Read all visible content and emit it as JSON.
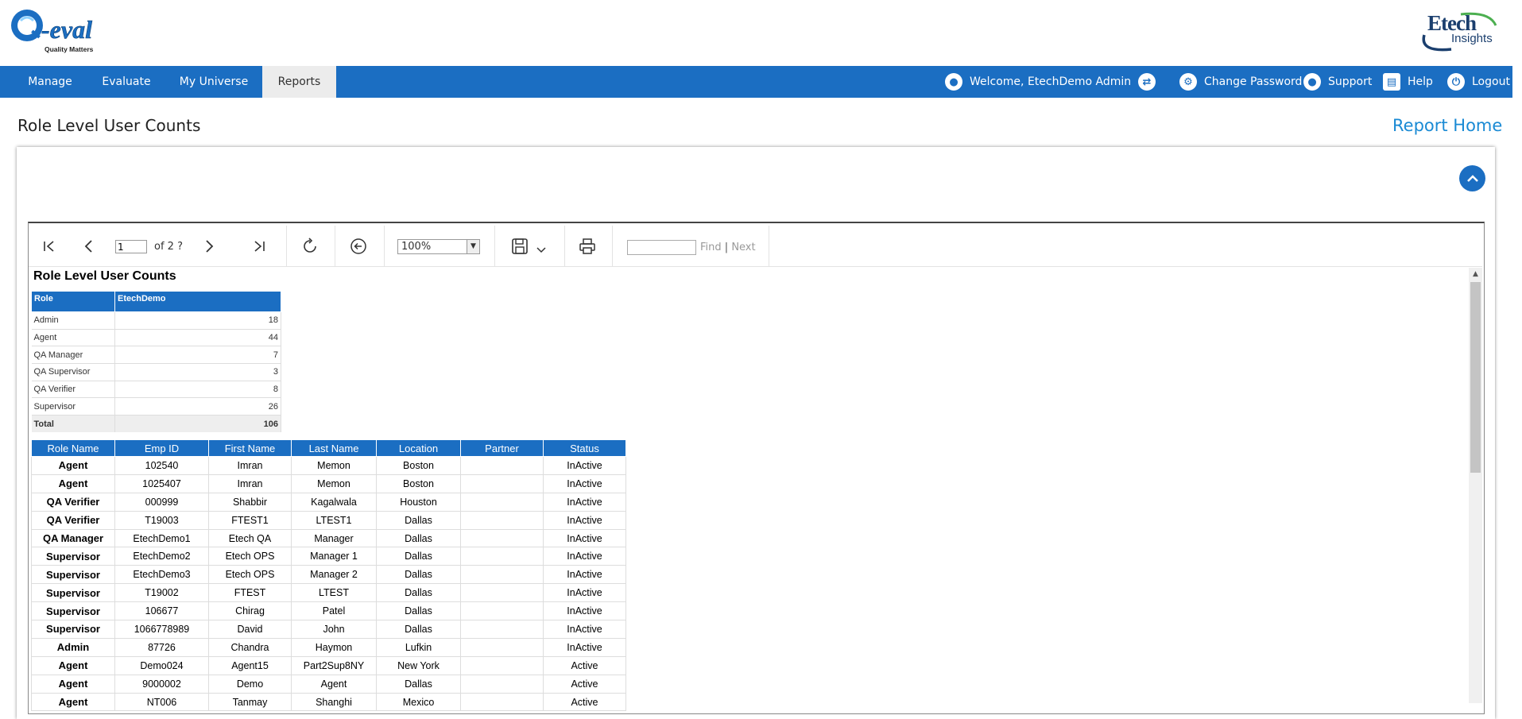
{
  "header": {
    "logo_left_text": "Q-Eval",
    "logo_left_tagline": "Quality Matters",
    "logo_right_text": "Etech",
    "logo_right_sub": "Insights"
  },
  "nav": {
    "items": [
      {
        "label": "Manage"
      },
      {
        "label": "Evaluate"
      },
      {
        "label": "My Universe"
      },
      {
        "label": "Reports"
      }
    ],
    "active": "Reports",
    "welcome": "Welcome, EtechDemo Admin",
    "change_password": "Change Password",
    "support": "Support",
    "help": "Help",
    "logout": "Logout"
  },
  "page": {
    "title": "Role Level User Counts",
    "report_home": "Report Home"
  },
  "toolbar": {
    "page_value": "1",
    "page_of": "of 2 ?",
    "zoom": "100%",
    "find_label": "Find",
    "separator": "|",
    "next_label": "Next"
  },
  "report": {
    "title": "Role Level User Counts",
    "summary_headers": [
      "Role",
      "EtechDemo"
    ],
    "summary_rows": [
      {
        "role": "Admin",
        "count": "18"
      },
      {
        "role": "Agent",
        "count": "44"
      },
      {
        "role": "QA Manager",
        "count": "7"
      },
      {
        "role": "QA Supervisor",
        "count": "3"
      },
      {
        "role": "QA Verifier",
        "count": "8"
      },
      {
        "role": "Supervisor",
        "count": "26"
      }
    ],
    "summary_total": {
      "label": "Total",
      "count": "106"
    },
    "detail_headers": [
      "Role Name",
      "Emp ID",
      "First Name",
      "Last Name",
      "Location",
      "Partner",
      "Status"
    ],
    "detail_rows": [
      [
        "Agent",
        "102540",
        "Imran",
        "Memon",
        "Boston",
        "",
        "InActive"
      ],
      [
        "Agent",
        "1025407",
        "Imran",
        "Memon",
        "Boston",
        "",
        "InActive"
      ],
      [
        "QA Verifier",
        "000999",
        "Shabbir",
        "Kagalwala",
        "Houston",
        "",
        "InActive"
      ],
      [
        "QA Verifier",
        "T19003",
        "FTEST1",
        "LTEST1",
        "Dallas",
        "",
        "InActive"
      ],
      [
        "QA Manager",
        "EtechDemo1",
        "Etech QA",
        "Manager",
        "Dallas",
        "",
        "InActive"
      ],
      [
        "Supervisor",
        "EtechDemo2",
        "Etech OPS",
        "Manager 1",
        "Dallas",
        "",
        "InActive"
      ],
      [
        "Supervisor",
        "EtechDemo3",
        "Etech OPS",
        "Manager 2",
        "Dallas",
        "",
        "InActive"
      ],
      [
        "Supervisor",
        "T19002",
        "FTEST",
        "LTEST",
        "Dallas",
        "",
        "InActive"
      ],
      [
        "Supervisor",
        "106677",
        "Chirag",
        "Patel",
        "Dallas",
        "",
        "InActive"
      ],
      [
        "Supervisor",
        "1066778989",
        "David",
        "John",
        "Dallas",
        "",
        "InActive"
      ],
      [
        "Admin",
        "87726",
        "Chandra",
        "Haymon",
        "Lufkin",
        "",
        "InActive"
      ],
      [
        "Agent",
        "Demo024",
        "Agent15",
        "Part2Sup8NY",
        "New York",
        "",
        "Active"
      ],
      [
        "Agent",
        "9000002",
        "Demo",
        "Agent",
        "Dallas",
        "",
        "Active"
      ],
      [
        "Agent",
        "NT006",
        "Tanmay",
        "Shanghi",
        "Mexico",
        "",
        "Active"
      ]
    ]
  },
  "colors": {
    "brand_blue": "#1b6ec2",
    "link_blue": "#1a8ad4"
  }
}
